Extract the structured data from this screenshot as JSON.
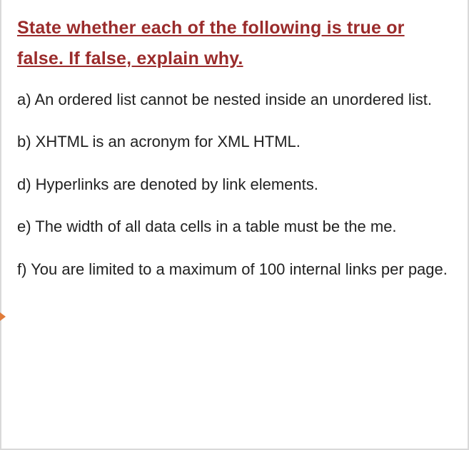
{
  "heading": "State whether each of the following is true or false. If false, explain why.",
  "items": [
    "a) An ordered list cannot be nested inside an unordered list.",
    "b) XHTML is an acronym for XML HTML.",
    "d) Hyperlinks are denoted by link elements.",
    "e) The width of all data cells in a table must be the    me.",
    "f) You are limited to a maximum of 100 internal links per page."
  ]
}
